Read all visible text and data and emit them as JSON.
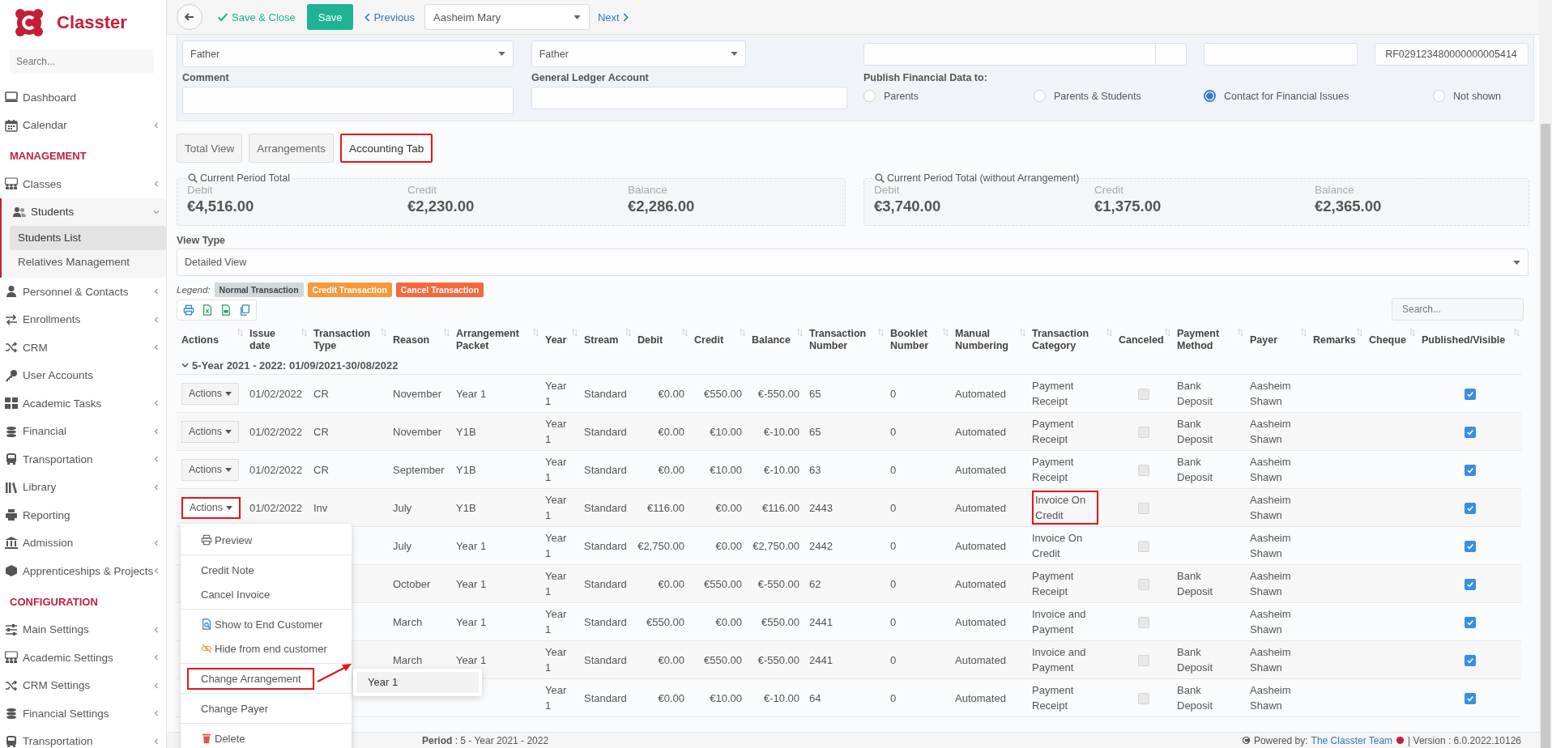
{
  "sidebar": {
    "brand": "Classter",
    "search_placeholder": "Search...",
    "sections": [
      {
        "items": [
          {
            "label": "Dashboard",
            "expandable": false,
            "expanded": false
          },
          {
            "label": "Calendar",
            "expandable": true,
            "expanded": false
          }
        ]
      },
      {
        "title": "MANAGEMENT",
        "items": [
          {
            "label": "Classes",
            "expandable": true,
            "expanded": false
          },
          {
            "label": "Students",
            "expandable": true,
            "expanded": true,
            "children": [
              {
                "label": "Students List",
                "selected": true
              },
              {
                "label": "Relatives Management",
                "selected": false
              }
            ]
          },
          {
            "label": "Personnel & Contacts",
            "expandable": true,
            "expanded": false
          },
          {
            "label": "Enrollments",
            "expandable": true,
            "expanded": false
          },
          {
            "label": "CRM",
            "expandable": true,
            "expanded": false
          },
          {
            "label": "User Accounts",
            "expandable": false,
            "expanded": false
          },
          {
            "label": "Academic Tasks",
            "expandable": true,
            "expanded": false
          },
          {
            "label": "Financial",
            "expandable": true,
            "expanded": false
          },
          {
            "label": "Transportation",
            "expandable": true,
            "expanded": false
          },
          {
            "label": "Library",
            "expandable": true,
            "expanded": false
          },
          {
            "label": "Reporting",
            "expandable": false,
            "expanded": false
          },
          {
            "label": "Admission",
            "expandable": true,
            "expanded": false
          },
          {
            "label": "Apprenticeships & Projects",
            "expandable": true,
            "expanded": false
          }
        ]
      },
      {
        "title": "CONFIGURATION",
        "items": [
          {
            "label": "Main Settings",
            "expandable": true,
            "expanded": false
          },
          {
            "label": "Academic Settings",
            "expandable": true,
            "expanded": false
          },
          {
            "label": "CRM Settings",
            "expandable": true,
            "expanded": false
          },
          {
            "label": "Financial Settings",
            "expandable": true,
            "expanded": false
          },
          {
            "label": "Transportation",
            "expandable": true,
            "expanded": false
          }
        ]
      }
    ]
  },
  "toolbar": {
    "save_close": "Save & Close",
    "save": "Save",
    "previous": "Previous",
    "record": "Aasheim Mary",
    "next": "Next"
  },
  "form": {
    "select_1": "Father",
    "select_2": "Father",
    "reference": "RF029123480000000005414",
    "comment_label": "Comment",
    "ledger_label": "General Ledger Account",
    "publish_label": "Publish Financial Data to:",
    "publish_options": [
      {
        "label": "Parents",
        "selected": false
      },
      {
        "label": "Parents & Students",
        "selected": false
      },
      {
        "label": "Contact for Financial Issues",
        "selected": true
      },
      {
        "label": "Not shown",
        "selected": false
      }
    ]
  },
  "tabs": [
    {
      "label": "Total View",
      "selected": false,
      "highlighted": false
    },
    {
      "label": "Arrangements",
      "selected": false,
      "highlighted": false
    },
    {
      "label": "Accounting Tab",
      "selected": true,
      "highlighted": true
    }
  ],
  "summaries": [
    {
      "title": "Current Period Total",
      "items": [
        {
          "label": "Debit",
          "value": "€4,516.00"
        },
        {
          "label": "Credit",
          "value": "€2,230.00"
        },
        {
          "label": "Balance",
          "value": "€2,286.00"
        }
      ]
    },
    {
      "title": "Current Period Total (without Arrangement)",
      "items": [
        {
          "label": "Debit",
          "value": "€3,740.00"
        },
        {
          "label": "Credit",
          "value": "€1,375.00"
        },
        {
          "label": "Balance",
          "value": "€2,365.00"
        }
      ]
    }
  ],
  "view_type": {
    "label": "View Type",
    "value": "Detailed View"
  },
  "legend": {
    "label": "Legend:",
    "items": [
      {
        "label": "Normal Transaction",
        "color": "#d1d8dc"
      },
      {
        "label": "Credit Transaction",
        "color": "#f7983a"
      },
      {
        "label": "Cancel Transaction",
        "color": "#f5683d"
      }
    ]
  },
  "table": {
    "search_placeholder": "Search...",
    "columns": [
      "Actions",
      "Issue date",
      "Transaction Type",
      "Reason",
      "Arrangement Packet",
      "Year",
      "Stream",
      "Debit",
      "Credit",
      "Balance",
      "Transaction Number",
      "Booklet Number",
      "Manual Numbering",
      "Transaction Category",
      "Canceled",
      "Payment Method",
      "Payer",
      "Remarks",
      "Cheque",
      "Published/Visible"
    ],
    "group": "5-Year 2021 - 2022: 01/09/2021-30/08/2022",
    "group_expanded": true,
    "rows": [
      {
        "actions": "Actions",
        "actions_highlighted": false,
        "menu_open": false,
        "issue_date": "01/02/2022",
        "type": "CR",
        "reason": "November",
        "arrangement": "Year 1",
        "year": "Year 1",
        "stream": "Standard",
        "debit": "€0.00",
        "credit": "€550.00",
        "balance": "€-550.00",
        "number": "65",
        "booklet": "0",
        "numbering": "Automated",
        "category": "Payment Receipt",
        "category_highlighted": false,
        "canceled": false,
        "method": "Bank Deposit",
        "payer": "Aasheim Shawn",
        "published": true
      },
      {
        "actions": "Actions",
        "actions_highlighted": false,
        "menu_open": false,
        "issue_date": "01/02/2022",
        "type": "CR",
        "reason": "November",
        "arrangement": "Y1B",
        "year": "Year 1",
        "stream": "Standard",
        "debit": "€0.00",
        "credit": "€10.00",
        "balance": "€-10.00",
        "number": "65",
        "booklet": "0",
        "numbering": "Automated",
        "category": "Payment Receipt",
        "category_highlighted": false,
        "canceled": false,
        "method": "Bank Deposit",
        "payer": "Aasheim Shawn",
        "published": true
      },
      {
        "actions": "Actions",
        "actions_highlighted": false,
        "menu_open": false,
        "issue_date": "01/02/2022",
        "type": "CR",
        "reason": "September",
        "arrangement": "Y1B",
        "year": "Year 1",
        "stream": "Standard",
        "debit": "€0.00",
        "credit": "€10.00",
        "balance": "€-10.00",
        "number": "63",
        "booklet": "0",
        "numbering": "Automated",
        "category": "Payment Receipt",
        "category_highlighted": false,
        "canceled": false,
        "method": "Bank Deposit",
        "payer": "Aasheim Shawn",
        "published": true
      },
      {
        "actions": "Actions",
        "actions_highlighted": true,
        "menu_open": true,
        "issue_date": "01/02/2022",
        "type": "Inv",
        "reason": "July",
        "arrangement": "Y1B",
        "year": "Year 1",
        "stream": "Standard",
        "debit": "€116.00",
        "credit": "€0.00",
        "balance": "€116.00",
        "number": "2443",
        "booklet": "0",
        "numbering": "Automated",
        "category": "Invoice On Credit",
        "category_highlighted": true,
        "canceled": false,
        "payer": "Aasheim Shawn",
        "published": true
      },
      {
        "reason": "July",
        "arrangement": "Year 1",
        "year": "Year 1",
        "stream": "Standard",
        "debit": "€2,750.00",
        "credit": "€0.00",
        "balance": "€2,750.00",
        "number": "2442",
        "booklet": "0",
        "numbering": "Automated",
        "category": "Invoice On Credit",
        "category_highlighted": false,
        "canceled": false,
        "payer": "Aasheim Shawn",
        "published": true
      },
      {
        "reason": "October",
        "arrangement": "Year 1",
        "year": "Year 1",
        "stream": "Standard",
        "debit": "€0.00",
        "credit": "€550.00",
        "balance": "€-550.00",
        "number": "62",
        "booklet": "0",
        "numbering": "Automated",
        "category": "Payment Receipt",
        "category_highlighted": false,
        "canceled": false,
        "method": "Bank Deposit",
        "payer": "Aasheim Shawn",
        "published": true
      },
      {
        "reason": "March",
        "arrangement": "Year 1",
        "year": "Year 1",
        "stream": "Standard",
        "debit": "€550.00",
        "credit": "€0.00",
        "balance": "€550.00",
        "number": "2441",
        "booklet": "0",
        "numbering": "Automated",
        "category": "Invoice and Payment",
        "category_highlighted": false,
        "canceled": false,
        "payer": "Aasheim Shawn",
        "published": true
      },
      {
        "reason": "March",
        "arrangement": "Year 1",
        "year": "Year 1",
        "stream": "Standard",
        "debit": "€0.00",
        "credit": "€550.00",
        "balance": "€-550.00",
        "number": "2441",
        "booklet": "0",
        "numbering": "Automated",
        "category": "Invoice and Payment",
        "category_highlighted": false,
        "canceled": false,
        "method": "Bank Deposit",
        "payer": "Aasheim Shawn",
        "published": true
      },
      {
        "year": "Year 1",
        "stream": "Standard",
        "debit": "€0.00",
        "credit": "€10.00",
        "balance": "€-10.00",
        "number": "64",
        "booklet": "0",
        "numbering": "Automated",
        "category": "Payment Receipt",
        "category_highlighted": false,
        "canceled": false,
        "method": "Bank Deposit",
        "payer": "Aasheim Shawn",
        "published": true
      }
    ]
  },
  "actions_menu": {
    "groups": [
      [
        {
          "label": "Preview",
          "highlighted": false
        }
      ],
      [
        {
          "label": "Credit Note",
          "highlighted": false
        },
        {
          "label": "Cancel Invoice",
          "highlighted": false
        }
      ],
      [
        {
          "label": "Show to End Customer",
          "highlighted": false
        },
        {
          "label": "Hide from end customer",
          "highlighted": false
        }
      ],
      [
        {
          "label": "Change Arrangement",
          "highlighted": true,
          "submenu": [
            {
              "label": "Year 1",
              "selected": true
            }
          ]
        }
      ],
      [
        {
          "label": "Change Payer",
          "highlighted": false
        }
      ],
      [
        {
          "label": "Delete",
          "highlighted": false
        }
      ]
    ]
  },
  "footer": {
    "period": "**Period** : 5 - Year 2021 - 2022",
    "powered_by": "Powered by:",
    "team": "The Classter Team",
    "version": "| Version : 6.0.2022.10126"
  }
}
